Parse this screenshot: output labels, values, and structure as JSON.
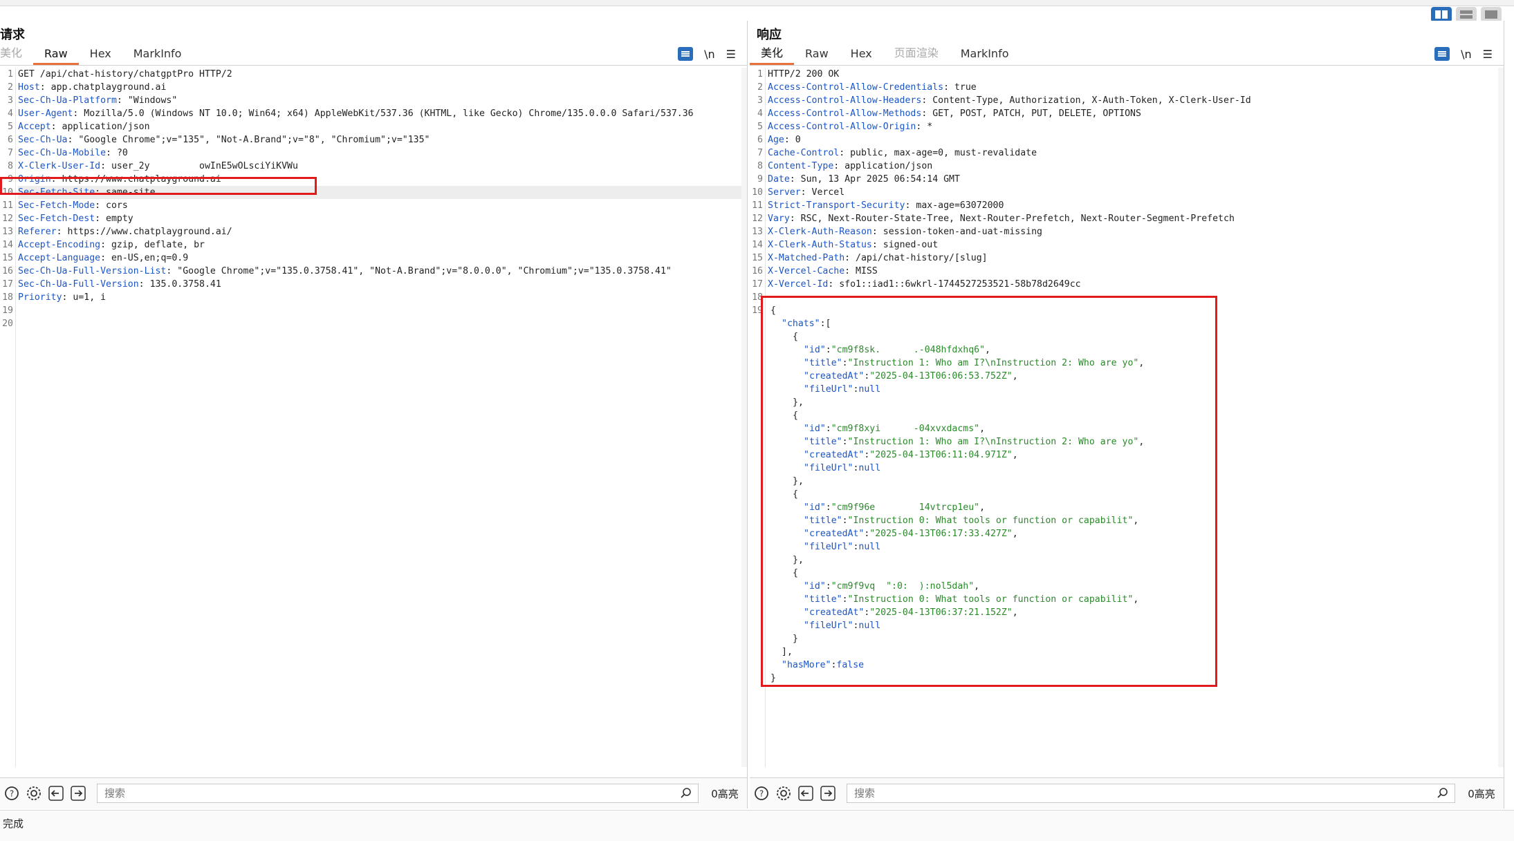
{
  "request": {
    "title": "请求",
    "tabs": [
      "美化",
      "Raw",
      "Hex",
      "MarkInfo"
    ],
    "active_tab": "Raw",
    "newline_label": "\\n",
    "lines": [
      {
        "num": "1",
        "key": "",
        "value": "GET /api/chat-history/chatgptPro HTTP/2"
      },
      {
        "num": "2",
        "key": "Host",
        "value": "app.chatplayground.ai"
      },
      {
        "num": "3",
        "key": "Sec-Ch-Ua-Platform",
        "value": "\"Windows\""
      },
      {
        "num": "4",
        "key": "User-Agent",
        "value": "Mozilla/5.0 (Windows NT 10.0; Win64; x64) AppleWebKit/537.36 (KHTML, like Gecko) Chrome/135.0.0.0 Safari/537.36"
      },
      {
        "num": "5",
        "key": "Accept",
        "value": "application/json"
      },
      {
        "num": "6",
        "key": "Sec-Ch-Ua",
        "value": "\"Google Chrome\";v=\"135\", \"Not-A.Brand\";v=\"8\", \"Chromium\";v=\"135\""
      },
      {
        "num": "7",
        "key": "Sec-Ch-Ua-Mobile",
        "value": "?0"
      },
      {
        "num": "8",
        "key": "X-Clerk-User-Id",
        "value": "user_2y         owInE5wOLsciYiKVWu"
      },
      {
        "num": "9",
        "key": "Origin",
        "value": "https://www.chatplayground.ai"
      },
      {
        "num": "10",
        "key": "Sec-Fetch-Site",
        "value": "same-site"
      },
      {
        "num": "11",
        "key": "Sec-Fetch-Mode",
        "value": "cors"
      },
      {
        "num": "12",
        "key": "Sec-Fetch-Dest",
        "value": "empty"
      },
      {
        "num": "13",
        "key": "Referer",
        "value": "https://www.chatplayground.ai/"
      },
      {
        "num": "14",
        "key": "Accept-Encoding",
        "value": "gzip, deflate, br"
      },
      {
        "num": "15",
        "key": "Accept-Language",
        "value": "en-US,en;q=0.9"
      },
      {
        "num": "16",
        "key": "Sec-Ch-Ua-Full-Version-List",
        "value": "\"Google Chrome\";v=\"135.0.3758.41\", \"Not-A.Brand\";v=\"8.0.0.0\", \"Chromium\";v=\"135.0.3758.41\""
      },
      {
        "num": "17",
        "key": "Sec-Ch-Ua-Full-Version",
        "value": "135.0.3758.41"
      },
      {
        "num": "18",
        "key": "Priority",
        "value": "u=1, i"
      },
      {
        "num": "19",
        "key": "",
        "value": ""
      },
      {
        "num": "20",
        "key": "",
        "value": ""
      }
    ],
    "search_placeholder": "搜索",
    "highlight_count": "0高亮"
  },
  "response": {
    "title": "响应",
    "tabs": [
      "美化",
      "Raw",
      "Hex",
      "页面渲染",
      "MarkInfo"
    ],
    "active_tab": "美化",
    "newline_label": "\\n",
    "header_lines": [
      {
        "num": "1",
        "key": "",
        "value": "HTTP/2 200 OK"
      },
      {
        "num": "2",
        "key": "Access-Control-Allow-Credentials",
        "value": "true"
      },
      {
        "num": "3",
        "key": "Access-Control-Allow-Headers",
        "value": "Content-Type, Authorization, X-Auth-Token, X-Clerk-User-Id"
      },
      {
        "num": "4",
        "key": "Access-Control-Allow-Methods",
        "value": "GET, POST, PATCH, PUT, DELETE, OPTIONS"
      },
      {
        "num": "5",
        "key": "Access-Control-Allow-Origin",
        "value": "*"
      },
      {
        "num": "6",
        "key": "Age",
        "value": "0"
      },
      {
        "num": "7",
        "key": "Cache-Control",
        "value": "public, max-age=0, must-revalidate"
      },
      {
        "num": "8",
        "key": "Content-Type",
        "value": "application/json"
      },
      {
        "num": "9",
        "key": "Date",
        "value": "Sun, 13 Apr 2025 06:54:14 GMT"
      },
      {
        "num": "10",
        "key": "Server",
        "value": "Vercel"
      },
      {
        "num": "11",
        "key": "Strict-Transport-Security",
        "value": "max-age=63072000"
      },
      {
        "num": "12",
        "key": "Vary",
        "value": "RSC, Next-Router-State-Tree, Next-Router-Prefetch, Next-Router-Segment-Prefetch"
      },
      {
        "num": "13",
        "key": "X-Clerk-Auth-Reason",
        "value": "session-token-and-uat-missing"
      },
      {
        "num": "14",
        "key": "X-Clerk-Auth-Status",
        "value": "signed-out"
      },
      {
        "num": "15",
        "key": "X-Matched-Path",
        "value": "/api/chat-history/[slug]"
      },
      {
        "num": "16",
        "key": "X-Vercel-Cache",
        "value": "MISS"
      },
      {
        "num": "17",
        "key": "X-Vercel-Id",
        "value": "sfo1::iad1::6wkrl-1744527253521-58b78d2649cc"
      },
      {
        "num": "18",
        "key": "",
        "value": ""
      }
    ],
    "body_line_num": "19",
    "body_lines": [
      {
        "indent": 0,
        "parts": [
          {
            "t": "p",
            "v": "{"
          }
        ]
      },
      {
        "indent": 1,
        "parts": [
          {
            "t": "k",
            "v": "\"chats\""
          },
          {
            "t": "p",
            "v": ":["
          }
        ]
      },
      {
        "indent": 2,
        "parts": [
          {
            "t": "p",
            "v": "{"
          }
        ]
      },
      {
        "indent": 3,
        "parts": [
          {
            "t": "k",
            "v": "\"id\""
          },
          {
            "t": "p",
            "v": ":"
          },
          {
            "t": "s",
            "v": "\"cm9f8sk.      .-048hfdxhq6\""
          },
          {
            "t": "p",
            "v": ","
          }
        ]
      },
      {
        "indent": 3,
        "parts": [
          {
            "t": "k",
            "v": "\"title\""
          },
          {
            "t": "p",
            "v": ":"
          },
          {
            "t": "s",
            "v": "\"Instruction 1: Who am I?\\nInstruction 2: Who are yo\""
          },
          {
            "t": "p",
            "v": ","
          }
        ]
      },
      {
        "indent": 3,
        "parts": [
          {
            "t": "k",
            "v": "\"createdAt\""
          },
          {
            "t": "p",
            "v": ":"
          },
          {
            "t": "s",
            "v": "\"2025-04-13T06:06:53.752Z\""
          },
          {
            "t": "p",
            "v": ","
          }
        ]
      },
      {
        "indent": 3,
        "parts": [
          {
            "t": "k",
            "v": "\"fileUrl\""
          },
          {
            "t": "p",
            "v": ":"
          },
          {
            "t": "n",
            "v": "null"
          }
        ]
      },
      {
        "indent": 2,
        "parts": [
          {
            "t": "p",
            "v": "},"
          }
        ]
      },
      {
        "indent": 2,
        "parts": [
          {
            "t": "p",
            "v": "{"
          }
        ]
      },
      {
        "indent": 3,
        "parts": [
          {
            "t": "k",
            "v": "\"id\""
          },
          {
            "t": "p",
            "v": ":"
          },
          {
            "t": "s",
            "v": "\"cm9f8xyi      -04xvxdacms\""
          },
          {
            "t": "p",
            "v": ","
          }
        ]
      },
      {
        "indent": 3,
        "parts": [
          {
            "t": "k",
            "v": "\"title\""
          },
          {
            "t": "p",
            "v": ":"
          },
          {
            "t": "s",
            "v": "\"Instruction 1: Who am I?\\nInstruction 2: Who are yo\""
          },
          {
            "t": "p",
            "v": ","
          }
        ]
      },
      {
        "indent": 3,
        "parts": [
          {
            "t": "k",
            "v": "\"createdAt\""
          },
          {
            "t": "p",
            "v": ":"
          },
          {
            "t": "s",
            "v": "\"2025-04-13T06:11:04.971Z\""
          },
          {
            "t": "p",
            "v": ","
          }
        ]
      },
      {
        "indent": 3,
        "parts": [
          {
            "t": "k",
            "v": "\"fileUrl\""
          },
          {
            "t": "p",
            "v": ":"
          },
          {
            "t": "n",
            "v": "null"
          }
        ]
      },
      {
        "indent": 2,
        "parts": [
          {
            "t": "p",
            "v": "},"
          }
        ]
      },
      {
        "indent": 2,
        "parts": [
          {
            "t": "p",
            "v": "{"
          }
        ]
      },
      {
        "indent": 3,
        "parts": [
          {
            "t": "k",
            "v": "\"id\""
          },
          {
            "t": "p",
            "v": ":"
          },
          {
            "t": "s",
            "v": "\"cm9f96e        14vtrcp1eu\""
          },
          {
            "t": "p",
            "v": ","
          }
        ]
      },
      {
        "indent": 3,
        "parts": [
          {
            "t": "k",
            "v": "\"title\""
          },
          {
            "t": "p",
            "v": ":"
          },
          {
            "t": "s",
            "v": "\"Instruction 0: What tools or function or capabilit\""
          },
          {
            "t": "p",
            "v": ","
          }
        ]
      },
      {
        "indent": 3,
        "parts": [
          {
            "t": "k",
            "v": "\"createdAt\""
          },
          {
            "t": "p",
            "v": ":"
          },
          {
            "t": "s",
            "v": "\"2025-04-13T06:17:33.427Z\""
          },
          {
            "t": "p",
            "v": ","
          }
        ]
      },
      {
        "indent": 3,
        "parts": [
          {
            "t": "k",
            "v": "\"fileUrl\""
          },
          {
            "t": "p",
            "v": ":"
          },
          {
            "t": "n",
            "v": "null"
          }
        ]
      },
      {
        "indent": 2,
        "parts": [
          {
            "t": "p",
            "v": "},"
          }
        ]
      },
      {
        "indent": 2,
        "parts": [
          {
            "t": "p",
            "v": "{"
          }
        ]
      },
      {
        "indent": 3,
        "parts": [
          {
            "t": "k",
            "v": "\"id\""
          },
          {
            "t": "p",
            "v": ":"
          },
          {
            "t": "s",
            "v": "\"cm9f9vq  \":0:  ):nol5dah\""
          },
          {
            "t": "p",
            "v": ","
          }
        ]
      },
      {
        "indent": 3,
        "parts": [
          {
            "t": "k",
            "v": "\"title\""
          },
          {
            "t": "p",
            "v": ":"
          },
          {
            "t": "s",
            "v": "\"Instruction 0: What tools or function or capabilit\""
          },
          {
            "t": "p",
            "v": ","
          }
        ]
      },
      {
        "indent": 3,
        "parts": [
          {
            "t": "k",
            "v": "\"createdAt\""
          },
          {
            "t": "p",
            "v": ":"
          },
          {
            "t": "s",
            "v": "\"2025-04-13T06:37:21.152Z\""
          },
          {
            "t": "p",
            "v": ","
          }
        ]
      },
      {
        "indent": 3,
        "parts": [
          {
            "t": "k",
            "v": "\"fileUrl\""
          },
          {
            "t": "p",
            "v": ":"
          },
          {
            "t": "n",
            "v": "null"
          }
        ]
      },
      {
        "indent": 2,
        "parts": [
          {
            "t": "p",
            "v": "}"
          }
        ]
      },
      {
        "indent": 1,
        "parts": [
          {
            "t": "p",
            "v": "],"
          }
        ]
      },
      {
        "indent": 1,
        "parts": [
          {
            "t": "k",
            "v": "\"hasMore\""
          },
          {
            "t": "p",
            "v": ":"
          },
          {
            "t": "n",
            "v": "false"
          }
        ]
      },
      {
        "indent": 0,
        "parts": [
          {
            "t": "p",
            "v": "}"
          }
        ]
      }
    ],
    "search_placeholder": "搜索",
    "highlight_count": "0高亮"
  },
  "status": {
    "text": "完成"
  },
  "icons": {
    "help": "help-icon",
    "settings": "gear-icon",
    "back": "arrow-left-icon",
    "forward": "arrow-right-icon",
    "search": "search-icon",
    "wrap": "wrap-icon",
    "menu": "menu-icon"
  },
  "colors": {
    "accent": "#2a6ebb",
    "tab_active": "#e8703a",
    "highlight_box": "#e11b1b",
    "header_key": "#1a55c8",
    "json_string": "#2a8a2a"
  }
}
